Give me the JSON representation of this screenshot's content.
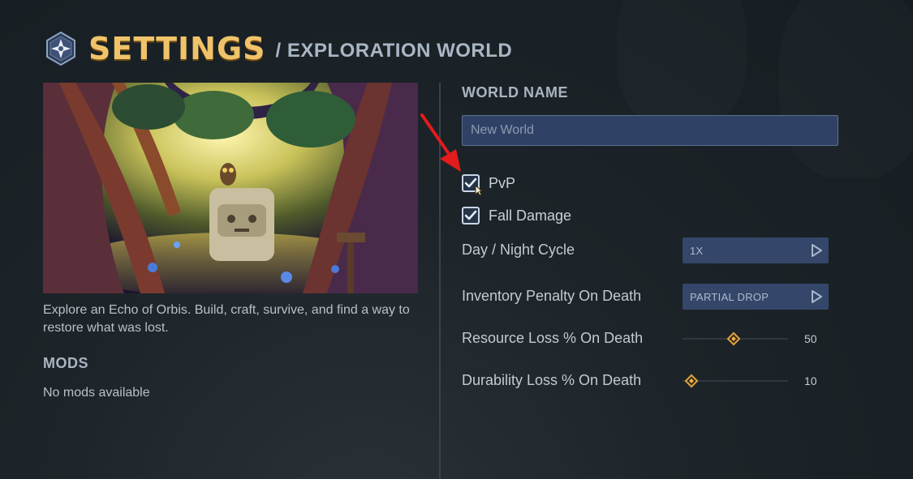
{
  "header": {
    "title": "SETTINGS",
    "subtitle": "/ EXPLORATION WORLD",
    "logo_icon": "compass-star-icon"
  },
  "world": {
    "description": "Explore an Echo of Orbis. Build, craft, survive, and find a way to restore what was lost."
  },
  "mods": {
    "heading": "MODS",
    "empty_text": "No mods available"
  },
  "world_name": {
    "heading": "WORLD NAME",
    "placeholder": "New World",
    "value": ""
  },
  "options": {
    "pvp": {
      "label": "PvP",
      "checked": true
    },
    "fall_damage": {
      "label": "Fall Damage",
      "checked": true
    }
  },
  "day_night": {
    "label": "Day / Night Cycle",
    "value": "1X"
  },
  "inventory_penalty": {
    "label": "Inventory Penalty On Death",
    "value": "PARTIAL DROP"
  },
  "resource_loss": {
    "label": "Resource Loss % On Death",
    "value": "50",
    "fraction": 0.5
  },
  "durability_loss": {
    "label": "Durability Loss % On Death",
    "value": "10",
    "fraction": 0.1
  },
  "colors": {
    "accent_gold": "#f0c36a",
    "select_bg": "#34476a",
    "input_bg": "#2f4266",
    "annotation_arrow": "#e41b1b"
  }
}
